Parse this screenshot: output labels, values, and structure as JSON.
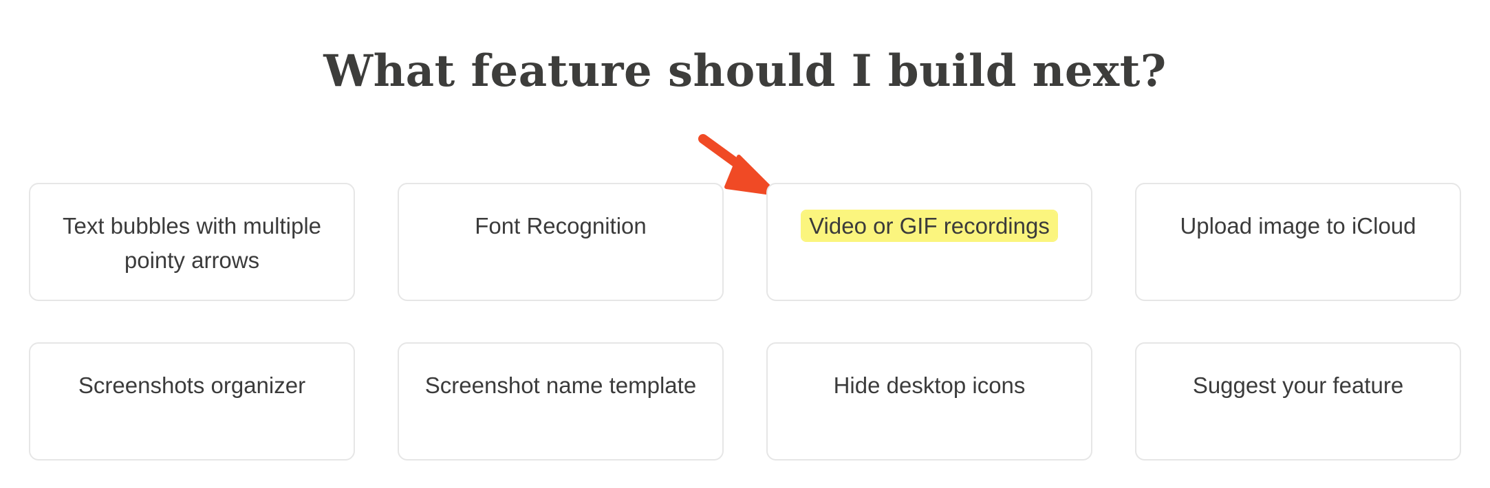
{
  "page": {
    "title": "What feature should I build next?"
  },
  "features": [
    {
      "label": "Text bubbles with multiple pointy arrows",
      "highlighted": false
    },
    {
      "label": "Font Recognition",
      "highlighted": false
    },
    {
      "label": "Video or GIF recordings",
      "highlighted": true
    },
    {
      "label": "Upload image to iCloud",
      "highlighted": false
    },
    {
      "label": "Screenshots organizer",
      "highlighted": false
    },
    {
      "label": "Screenshot name template",
      "highlighted": false
    },
    {
      "label": "Hide desktop icons",
      "highlighted": false
    },
    {
      "label": "Suggest your feature",
      "highlighted": false
    }
  ],
  "colors": {
    "highlight": "#fbf57e",
    "arrow": "#f04a25",
    "card_border": "#e6e6e6",
    "text": "#3b3b3b"
  },
  "icons": {
    "annotation_arrow": "arrow-icon"
  }
}
